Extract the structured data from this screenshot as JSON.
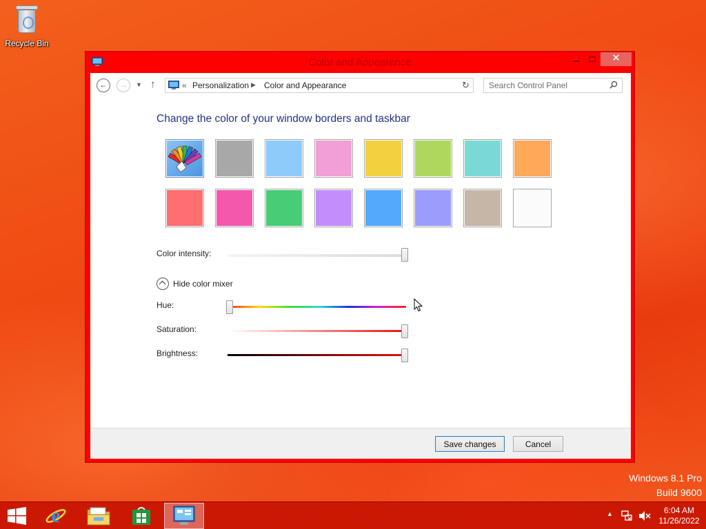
{
  "desktop": {
    "recycle_bin_label": "Recycle Bin",
    "recycle_bin_icon": "recycle-bin-icon"
  },
  "window": {
    "title": "Color and Appearance",
    "title_icon": "control-panel-icon",
    "controls": {
      "minimize": "minimize",
      "maximize": "maximize",
      "close": "✕"
    },
    "accent_color": "#ff0000"
  },
  "navigation": {
    "back_icon": "arrow-left-icon",
    "forward_icon": "arrow-right-icon",
    "recent_icon": "chevron-down-icon",
    "up_icon": "arrow-up-icon",
    "address_chevrons": "«",
    "breadcrumbs": [
      "Personalization",
      "Color and Appearance"
    ],
    "refresh_icon": "refresh-icon",
    "search_placeholder": "Search Control Panel"
  },
  "content": {
    "heading": "Change the color of your window borders and taskbar",
    "swatches": [
      {
        "name": "automatic",
        "color": "#5ea4e8",
        "selected": true
      },
      {
        "name": "gray",
        "color": "#a8a8a8"
      },
      {
        "name": "light-blue",
        "color": "#8ecbfb"
      },
      {
        "name": "pink",
        "color": "#f19fd5"
      },
      {
        "name": "yellow",
        "color": "#f3d03f"
      },
      {
        "name": "green",
        "color": "#b0d75d"
      },
      {
        "name": "teal",
        "color": "#7bd9d5"
      },
      {
        "name": "orange",
        "color": "#fea85a"
      },
      {
        "name": "red",
        "color": "#ff6f71"
      },
      {
        "name": "magenta",
        "color": "#f358ad"
      },
      {
        "name": "emerald",
        "color": "#47cd76"
      },
      {
        "name": "violet",
        "color": "#c48dfc"
      },
      {
        "name": "blue",
        "color": "#54a9fd"
      },
      {
        "name": "lavender",
        "color": "#9b9cfb"
      },
      {
        "name": "taupe",
        "color": "#c5b6a8"
      },
      {
        "name": "white",
        "color": "#fbfbfb"
      }
    ],
    "color_intensity_label": "Color intensity:",
    "color_intensity_value": 1.0,
    "mixer_toggle_label": "Hide color mixer",
    "hue_label": "Hue:",
    "hue_value": 0.0,
    "saturation_label": "Saturation:",
    "saturation_value": 1.0,
    "brightness_label": "Brightness:",
    "brightness_value": 1.0
  },
  "footer": {
    "save_label": "Save changes",
    "cancel_label": "Cancel"
  },
  "watermark": {
    "line1": "Windows 8.1 Pro",
    "line2": "Build 9600"
  },
  "taskbar": {
    "items": [
      "start-icon",
      "internet-explorer-icon",
      "file-explorer-icon",
      "store-icon",
      "control-panel-icon"
    ],
    "active_item": "control-panel-icon",
    "tray_arrow": "▲",
    "time": "6:04 AM",
    "date": "11/26/2022"
  }
}
